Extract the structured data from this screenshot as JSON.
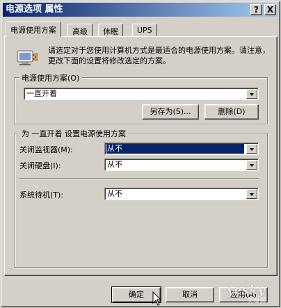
{
  "window": {
    "title": "电源选项 属性",
    "help_btn": "?",
    "close_btn": "X"
  },
  "tabs": [
    {
      "label": "电源使用方案",
      "active": true
    },
    {
      "label": "高级"
    },
    {
      "label": "休眠"
    },
    {
      "label": "UPS"
    }
  ],
  "intro_text": "请选定对于您使用计算机方式是最适合的电源使用方案。请注意，更改下面的设置将修改选定的方案。",
  "scheme_group": {
    "legend": "电源使用方案(O)",
    "selected": "一直开着",
    "save_as_label": "另存为(S)...",
    "delete_label": "删除(D)"
  },
  "settings_group": {
    "legend": "为 一直开着 设置电源使用方案",
    "monitor_label": "关闭监视器(M):",
    "monitor_value": "从不",
    "harddisk_label": "关闭硬盘(I):",
    "harddisk_value": "从不",
    "standby_label": "系统待机(T):",
    "standby_value": "从不"
  },
  "footer": {
    "ok_label": "确定",
    "cancel_label": "取消",
    "apply_label": "应用(A)"
  },
  "watermark": {
    "main": "yesky",
    "sub": "天极网"
  }
}
